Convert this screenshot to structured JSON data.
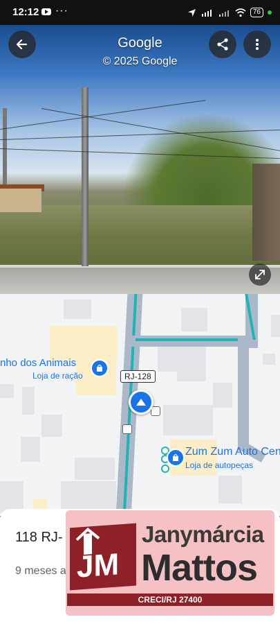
{
  "status_bar": {
    "time": "12:12",
    "more": "···",
    "battery": "76"
  },
  "street_view": {
    "title": "Google",
    "subtitle": "© 2025 Google"
  },
  "map": {
    "route_label": "RJ-128",
    "poi_left": {
      "name": "nho dos Animais",
      "category": "Loja de ração"
    },
    "poi_right": {
      "name": "Zum Zum Auto Cen",
      "category": "Loja de autopeças"
    }
  },
  "card": {
    "address": "118 RJ-",
    "time_ago": "9 meses a"
  },
  "watermark": {
    "initials": "JM",
    "name_first": "Janymárcia",
    "name_last": "Mattos",
    "registry": "CRECI/RJ 27400"
  },
  "colors": {
    "accent": "#1a73e8",
    "route_highlight": "#1fb3b3",
    "brand": "#8e2128",
    "logo_bg": "#f6c1c4"
  }
}
